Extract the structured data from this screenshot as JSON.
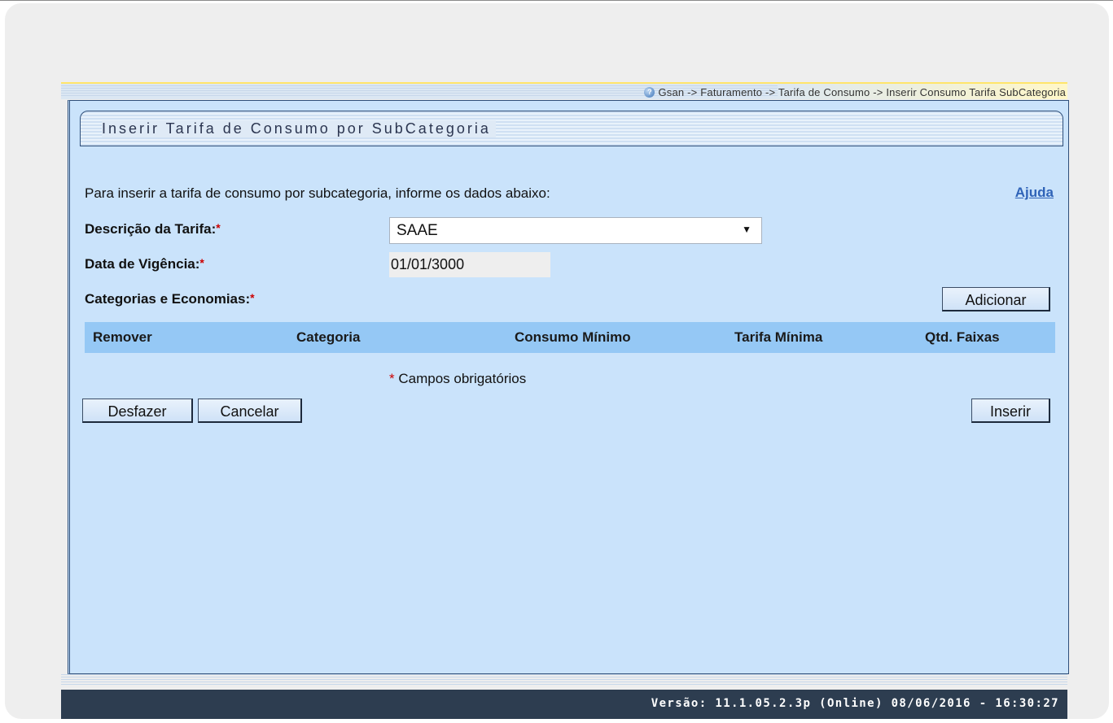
{
  "breadcrumb": {
    "text": "Gsan -> Faturamento -> Tarifa de Consumo -> Inserir Consumo Tarifa SubCategoria"
  },
  "page": {
    "title": "Inserir Tarifa de Consumo por SubCategoria",
    "instructions": "Para inserir a tarifa de consumo por subcategoria, informe os dados abaixo:",
    "help_link": "Ajuda"
  },
  "form": {
    "descricao_label": "Descrição da Tarifa:",
    "descricao_value": "SAAE",
    "data_label": "Data de Vigência:",
    "data_value": "01/01/3000",
    "categorias_label": "Categorias e Economias:",
    "required_marker": "*",
    "required_note": "Campos obrigatórios"
  },
  "table": {
    "columns": [
      "Remover",
      "Categoria",
      "Consumo Mínimo",
      "Tarifa Mínima",
      "Qtd. Faixas"
    ]
  },
  "buttons": {
    "adicionar": "Adicionar",
    "desfazer": "Desfazer",
    "cancelar": "Cancelar",
    "inserir": "Inserir"
  },
  "footer": {
    "version": "Versão: 11.1.05.2.3p (Online) 08/06/2016 - 16:30:27"
  },
  "colors": {
    "panel_bg": "#cae3fb",
    "table_header_bg": "#95c8f5",
    "footer_bg": "#2d3d50",
    "link": "#2f63b8",
    "required": "#cc0000"
  },
  "icons": {
    "help": "help-circle-icon",
    "dropdown": "chevron-down-icon"
  }
}
